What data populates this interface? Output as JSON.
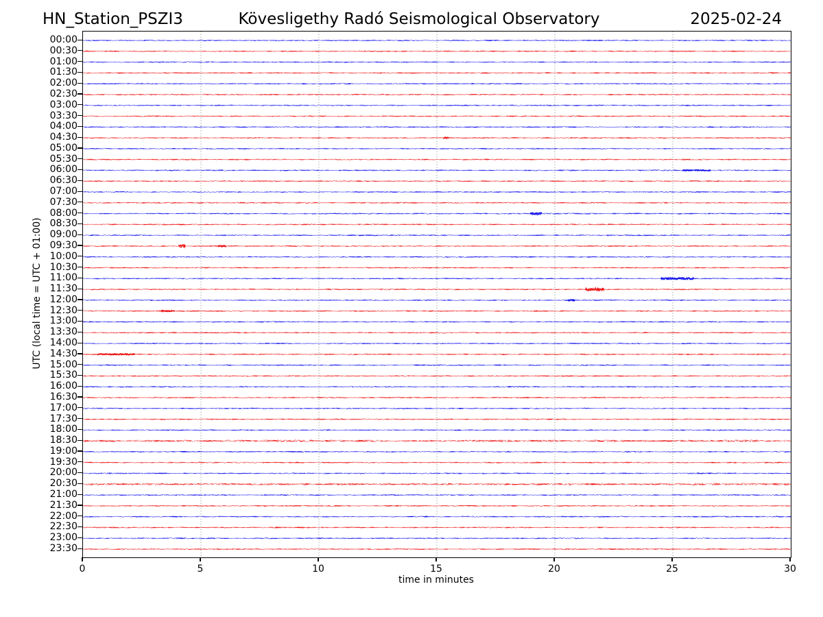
{
  "header": {
    "station": "HN_Station_PSZI3",
    "observatory": "Kövesligethy Radó Seismological Observatory",
    "date": "2025-02-24"
  },
  "chart_data": {
    "type": "line",
    "subtype": "helicorder-day-plot",
    "description": "48 half-hour seismic traces, flat low-amplitude noise baselines, hour traces blue and half-hour traces red",
    "title_left": "HN_Station_PSZI3",
    "title_center": "Kövesligethy Radó Seismological Observatory",
    "title_right": "2025-02-24",
    "xlabel": "time in minutes",
    "ylabel": "UTC (local time = UTC + 01:00)",
    "xlim": [
      0,
      30
    ],
    "x_ticks": [
      0,
      5,
      10,
      15,
      20,
      25,
      30
    ],
    "grid": {
      "vertical_minutes": [
        5,
        10,
        15,
        20,
        25
      ],
      "style": "dotted",
      "color": "#8a8a8a"
    },
    "colors": {
      "hour_trace": "#0000ee",
      "half_hour_trace": "#ee0000",
      "frame": "#000000"
    },
    "rows": [
      {
        "label": "00:00",
        "color": "#0000ee"
      },
      {
        "label": "00:30",
        "color": "#ee0000"
      },
      {
        "label": "01:00",
        "color": "#0000ee"
      },
      {
        "label": "01:30",
        "color": "#ee0000"
      },
      {
        "label": "02:00",
        "color": "#0000ee"
      },
      {
        "label": "02:30",
        "color": "#ee0000"
      },
      {
        "label": "03:00",
        "color": "#0000ee"
      },
      {
        "label": "03:30",
        "color": "#ee0000"
      },
      {
        "label": "04:00",
        "color": "#0000ee"
      },
      {
        "label": "04:30",
        "color": "#ee0000"
      },
      {
        "label": "05:00",
        "color": "#0000ee"
      },
      {
        "label": "05:30",
        "color": "#ee0000"
      },
      {
        "label": "06:00",
        "color": "#0000ee"
      },
      {
        "label": "06:30",
        "color": "#ee0000"
      },
      {
        "label": "07:00",
        "color": "#0000ee"
      },
      {
        "label": "07:30",
        "color": "#ee0000"
      },
      {
        "label": "08:00",
        "color": "#0000ee"
      },
      {
        "label": "08:30",
        "color": "#ee0000"
      },
      {
        "label": "09:00",
        "color": "#0000ee"
      },
      {
        "label": "09:30",
        "color": "#ee0000"
      },
      {
        "label": "10:00",
        "color": "#0000ee"
      },
      {
        "label": "10:30",
        "color": "#ee0000"
      },
      {
        "label": "11:00",
        "color": "#0000ee"
      },
      {
        "label": "11:30",
        "color": "#ee0000"
      },
      {
        "label": "12:00",
        "color": "#0000ee"
      },
      {
        "label": "12:30",
        "color": "#ee0000"
      },
      {
        "label": "13:00",
        "color": "#0000ee"
      },
      {
        "label": "13:30",
        "color": "#ee0000"
      },
      {
        "label": "14:00",
        "color": "#0000ee"
      },
      {
        "label": "14:30",
        "color": "#ee0000"
      },
      {
        "label": "15:00",
        "color": "#0000ee"
      },
      {
        "label": "15:30",
        "color": "#ee0000"
      },
      {
        "label": "16:00",
        "color": "#0000ee"
      },
      {
        "label": "16:30",
        "color": "#ee0000"
      },
      {
        "label": "17:00",
        "color": "#0000ee"
      },
      {
        "label": "17:30",
        "color": "#ee0000"
      },
      {
        "label": "18:00",
        "color": "#0000ee"
      },
      {
        "label": "18:30",
        "color": "#ee0000",
        "band": true
      },
      {
        "label": "19:00",
        "color": "#0000ee"
      },
      {
        "label": "19:30",
        "color": "#ee0000"
      },
      {
        "label": "20:00",
        "color": "#0000ee"
      },
      {
        "label": "20:30",
        "color": "#ee0000",
        "band": true
      },
      {
        "label": "21:00",
        "color": "#0000ee"
      },
      {
        "label": "21:30",
        "color": "#ee0000"
      },
      {
        "label": "22:00",
        "color": "#0000ee"
      },
      {
        "label": "22:30",
        "color": "#ee0000"
      },
      {
        "label": "23:00",
        "color": "#0000ee"
      },
      {
        "label": "23:30",
        "color": "#ee0000"
      }
    ],
    "events": [
      {
        "row": "04:30",
        "minute": 15.4,
        "duration": 0.25,
        "amp": 1.6
      },
      {
        "row": "06:00",
        "minute": 26.0,
        "duration": 1.2,
        "amp": 1.2
      },
      {
        "row": "08:00",
        "minute": 19.2,
        "duration": 0.5,
        "amp": 2.0
      },
      {
        "row": "09:30",
        "minute": 4.2,
        "duration": 0.3,
        "amp": 2.2
      },
      {
        "row": "09:30",
        "minute": 5.9,
        "duration": 0.35,
        "amp": 1.6
      },
      {
        "row": "11:00",
        "minute": 25.2,
        "duration": 1.4,
        "amp": 1.8
      },
      {
        "row": "11:30",
        "minute": 21.7,
        "duration": 0.8,
        "amp": 2.4
      },
      {
        "row": "12:00",
        "minute": 20.7,
        "duration": 0.3,
        "amp": 1.5
      },
      {
        "row": "12:30",
        "minute": 3.6,
        "duration": 0.6,
        "amp": 1.3
      },
      {
        "row": "14:30",
        "minute": 1.4,
        "duration": 1.6,
        "amp": 1.3
      }
    ]
  }
}
